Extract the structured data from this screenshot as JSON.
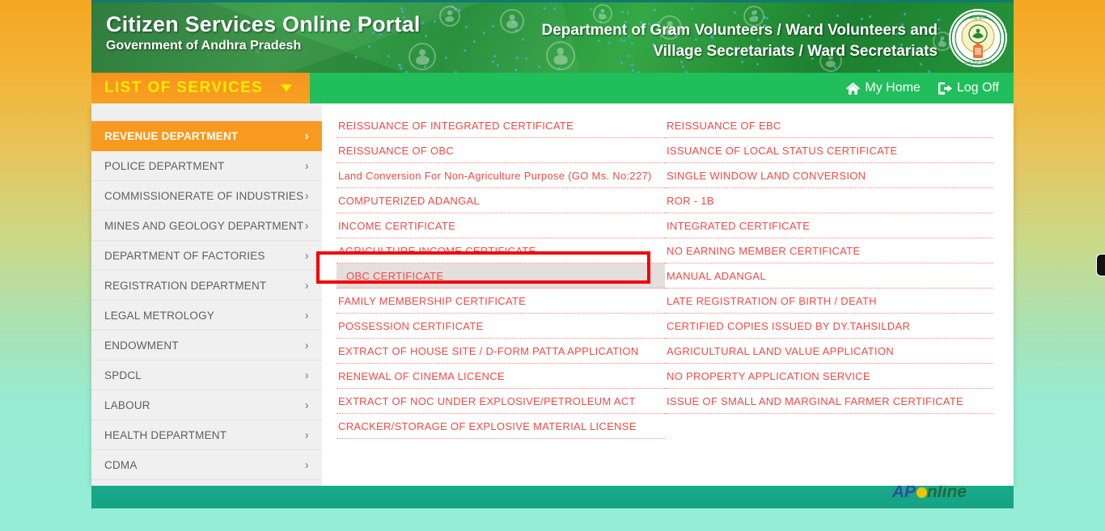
{
  "header": {
    "title": "Citizen Services Online Portal",
    "subtitle": "Government of Andhra Pradesh",
    "department_line1": "Department of Gram Volunteers / Ward Volunteers and",
    "department_line2": "Village Secretariats / Ward Secretariats",
    "emblem_name": "andhra-pradesh-state-emblem",
    "banner_green": "#2c9b3c"
  },
  "nav": {
    "services_label": "LIST OF SERVICES",
    "caret_icon": "chevron-down-icon",
    "links": [
      {
        "label": "My Home",
        "icon": "home-icon"
      },
      {
        "label": "Log Off",
        "icon": "logout-icon"
      }
    ],
    "bar_color": "#21bf5b",
    "button_color": "#f79a1f",
    "button_text_color": "#ffeb00"
  },
  "sidebar": {
    "active_index": 0,
    "chevron_icon": "chevron-right-icon",
    "items": [
      {
        "label": "REVENUE DEPARTMENT"
      },
      {
        "label": "POLICE DEPARTMENT"
      },
      {
        "label": "COMMISSIONERATE OF INDUSTRIES"
      },
      {
        "label": "MINES AND GEOLOGY DEPARTMENT"
      },
      {
        "label": "DEPARTMENT OF FACTORIES"
      },
      {
        "label": "REGISTRATION DEPARTMENT"
      },
      {
        "label": "LEGAL METROLOGY"
      },
      {
        "label": "ENDOWMENT"
      },
      {
        "label": "SPDCL"
      },
      {
        "label": "LABOUR"
      },
      {
        "label": "HEALTH DEPARTMENT"
      },
      {
        "label": "CDMA"
      }
    ]
  },
  "services": {
    "link_color": "#ef4a45",
    "highlight_border_color": "#f40000",
    "selected_label": "OBC CERTIFICATE",
    "left_column": [
      {
        "label": "REISSUANCE OF INTEGRATED CERTIFICATE",
        "selected": false
      },
      {
        "label": "REISSUANCE OF OBC",
        "selected": false
      },
      {
        "label": "Land Conversion For Non-Agriculture Purpose (GO Ms. No:227)",
        "selected": false
      },
      {
        "label": "COMPUTERIZED ADANGAL",
        "selected": false
      },
      {
        "label": "INCOME CERTIFICATE",
        "selected": false
      },
      {
        "label": "AGRICULTURE INCOME CERTIFICATE",
        "selected": false
      },
      {
        "label": "OBC CERTIFICATE",
        "selected": true
      },
      {
        "label": "FAMILY MEMBERSHIP CERTIFICATE",
        "selected": false
      },
      {
        "label": "POSSESSION CERTIFICATE",
        "selected": false
      },
      {
        "label": "EXTRACT OF HOUSE SITE / D-FORM PATTA APPLICATION",
        "selected": false
      },
      {
        "label": "RENEWAL OF CINEMA LICENCE",
        "selected": false
      },
      {
        "label": "EXTRACT OF NOC UNDER EXPLOSIVE/PETROLEUM ACT",
        "selected": false
      },
      {
        "label": "CRACKER/STORAGE OF EXPLOSIVE MATERIAL LICENSE",
        "selected": false
      }
    ],
    "right_column": [
      {
        "label": "REISSUANCE OF EBC",
        "selected": false
      },
      {
        "label": "ISSUANCE OF LOCAL STATUS CERTIFICATE",
        "selected": false
      },
      {
        "label": "SINGLE WINDOW LAND CONVERSION",
        "selected": false
      },
      {
        "label": "ROR - 1B",
        "selected": false
      },
      {
        "label": "INTEGRATED CERTIFICATE",
        "selected": false
      },
      {
        "label": "NO EARNING MEMBER CERTIFICATE",
        "selected": false
      },
      {
        "label": "MANUAL ADANGAL",
        "selected": false
      },
      {
        "label": "LATE REGISTRATION OF BIRTH / DEATH",
        "selected": false
      },
      {
        "label": "CERTIFIED COPIES ISSUED BY DY.TAHSILDAR",
        "selected": false
      },
      {
        "label": "AGRICULTURAL LAND VALUE APPLICATION",
        "selected": false
      },
      {
        "label": "NO PROPERTY APPLICATION SERVICE",
        "selected": false
      },
      {
        "label": "ISSUE OF SMALL AND MARGINAL FARMER CERTIFICATE",
        "selected": false
      }
    ]
  },
  "footer": {
    "logo_ap": "AP",
    "logo_online": "nline",
    "logo_name": "ap-online-logo",
    "bar_color": "#17a183"
  },
  "edge_widget": {
    "name": "side-widget-tab"
  }
}
